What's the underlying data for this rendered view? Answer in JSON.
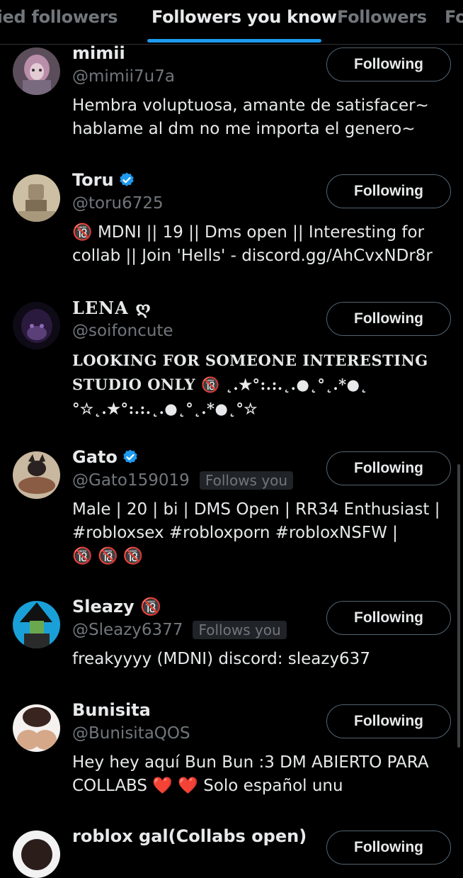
{
  "tabs": [
    {
      "label": "Verified followers",
      "visible_label": "rified followers",
      "active": false
    },
    {
      "label": "Followers you know",
      "active": true
    },
    {
      "label": "Followers",
      "active": false
    },
    {
      "label": "Fo",
      "active": false
    }
  ],
  "colors": {
    "background": "#000000",
    "accent": "#1d9bf0",
    "text_primary": "#e7e9ea",
    "text_secondary": "#71767b",
    "badge_bg": "#202327"
  },
  "follow_badge_label": "Follows you",
  "users": [
    {
      "name": "mimii",
      "handle": "@mimii7u7a",
      "verified": false,
      "follows_you": false,
      "button": "Following",
      "bio": "Hembra voluptuosa, amante de satisfacer~\nhablame al dm no me importa el genero~",
      "avatar_icon": "anime-girl-avatar"
    },
    {
      "name": "Toru",
      "handle": "@toru6725",
      "verified": true,
      "follows_you": false,
      "button": "Following",
      "bio": "🔞 MDNI || 19 || Dms open || Interesting for\ncollab || Join 'Hells' - discord.gg/AhCvxNDr8r",
      "avatar_icon": "sepia-figure-avatar"
    },
    {
      "name": "LENA ღ",
      "handle": "@soifoncute",
      "verified": false,
      "follows_you": false,
      "button": "Following",
      "bio": "LOOKING FOR SOMEONE INTERESTING\nSTUDIO ONLY 🔞 ˛.★°:.:.˛.●˛°˛.*●˛\n°☆˛.★°:.:.˛.●˛°˛.*●˛°☆",
      "avatar_icon": "dark-purple-avatar"
    },
    {
      "name": "Gato",
      "handle": "@Gato159019",
      "verified": true,
      "follows_you": true,
      "button": "Following",
      "bio": "Male | 20 | bi | DMS Open | RR34 Enthusiast |\n#robloxsex #robloxporn #robloxNSFW |\n🔞 🔞 🔞",
      "avatar_icon": "cat-ears-avatar"
    },
    {
      "name": "Sleazy 🔞",
      "handle": "@Sleazy6377",
      "verified": false,
      "follows_you": true,
      "button": "Following",
      "bio": "freakyyyy (MDNI) discord: sleazy637",
      "avatar_icon": "witch-hat-avatar"
    },
    {
      "name": "Bunisita",
      "handle": "@BunisitaQOS",
      "verified": false,
      "follows_you": false,
      "button": "Following",
      "bio": "Hey hey aquí Bun Bun :3 DM ABIERTO PARA\nCOLLABS ❤️ ❤️  Solo español unu",
      "avatar_icon": "bun-avatar"
    },
    {
      "name": "roblox gal(Collabs open)",
      "handle": "",
      "verified": false,
      "follows_you": false,
      "button": "Following",
      "bio": "",
      "avatar_icon": "roblox-gal-avatar"
    }
  ]
}
